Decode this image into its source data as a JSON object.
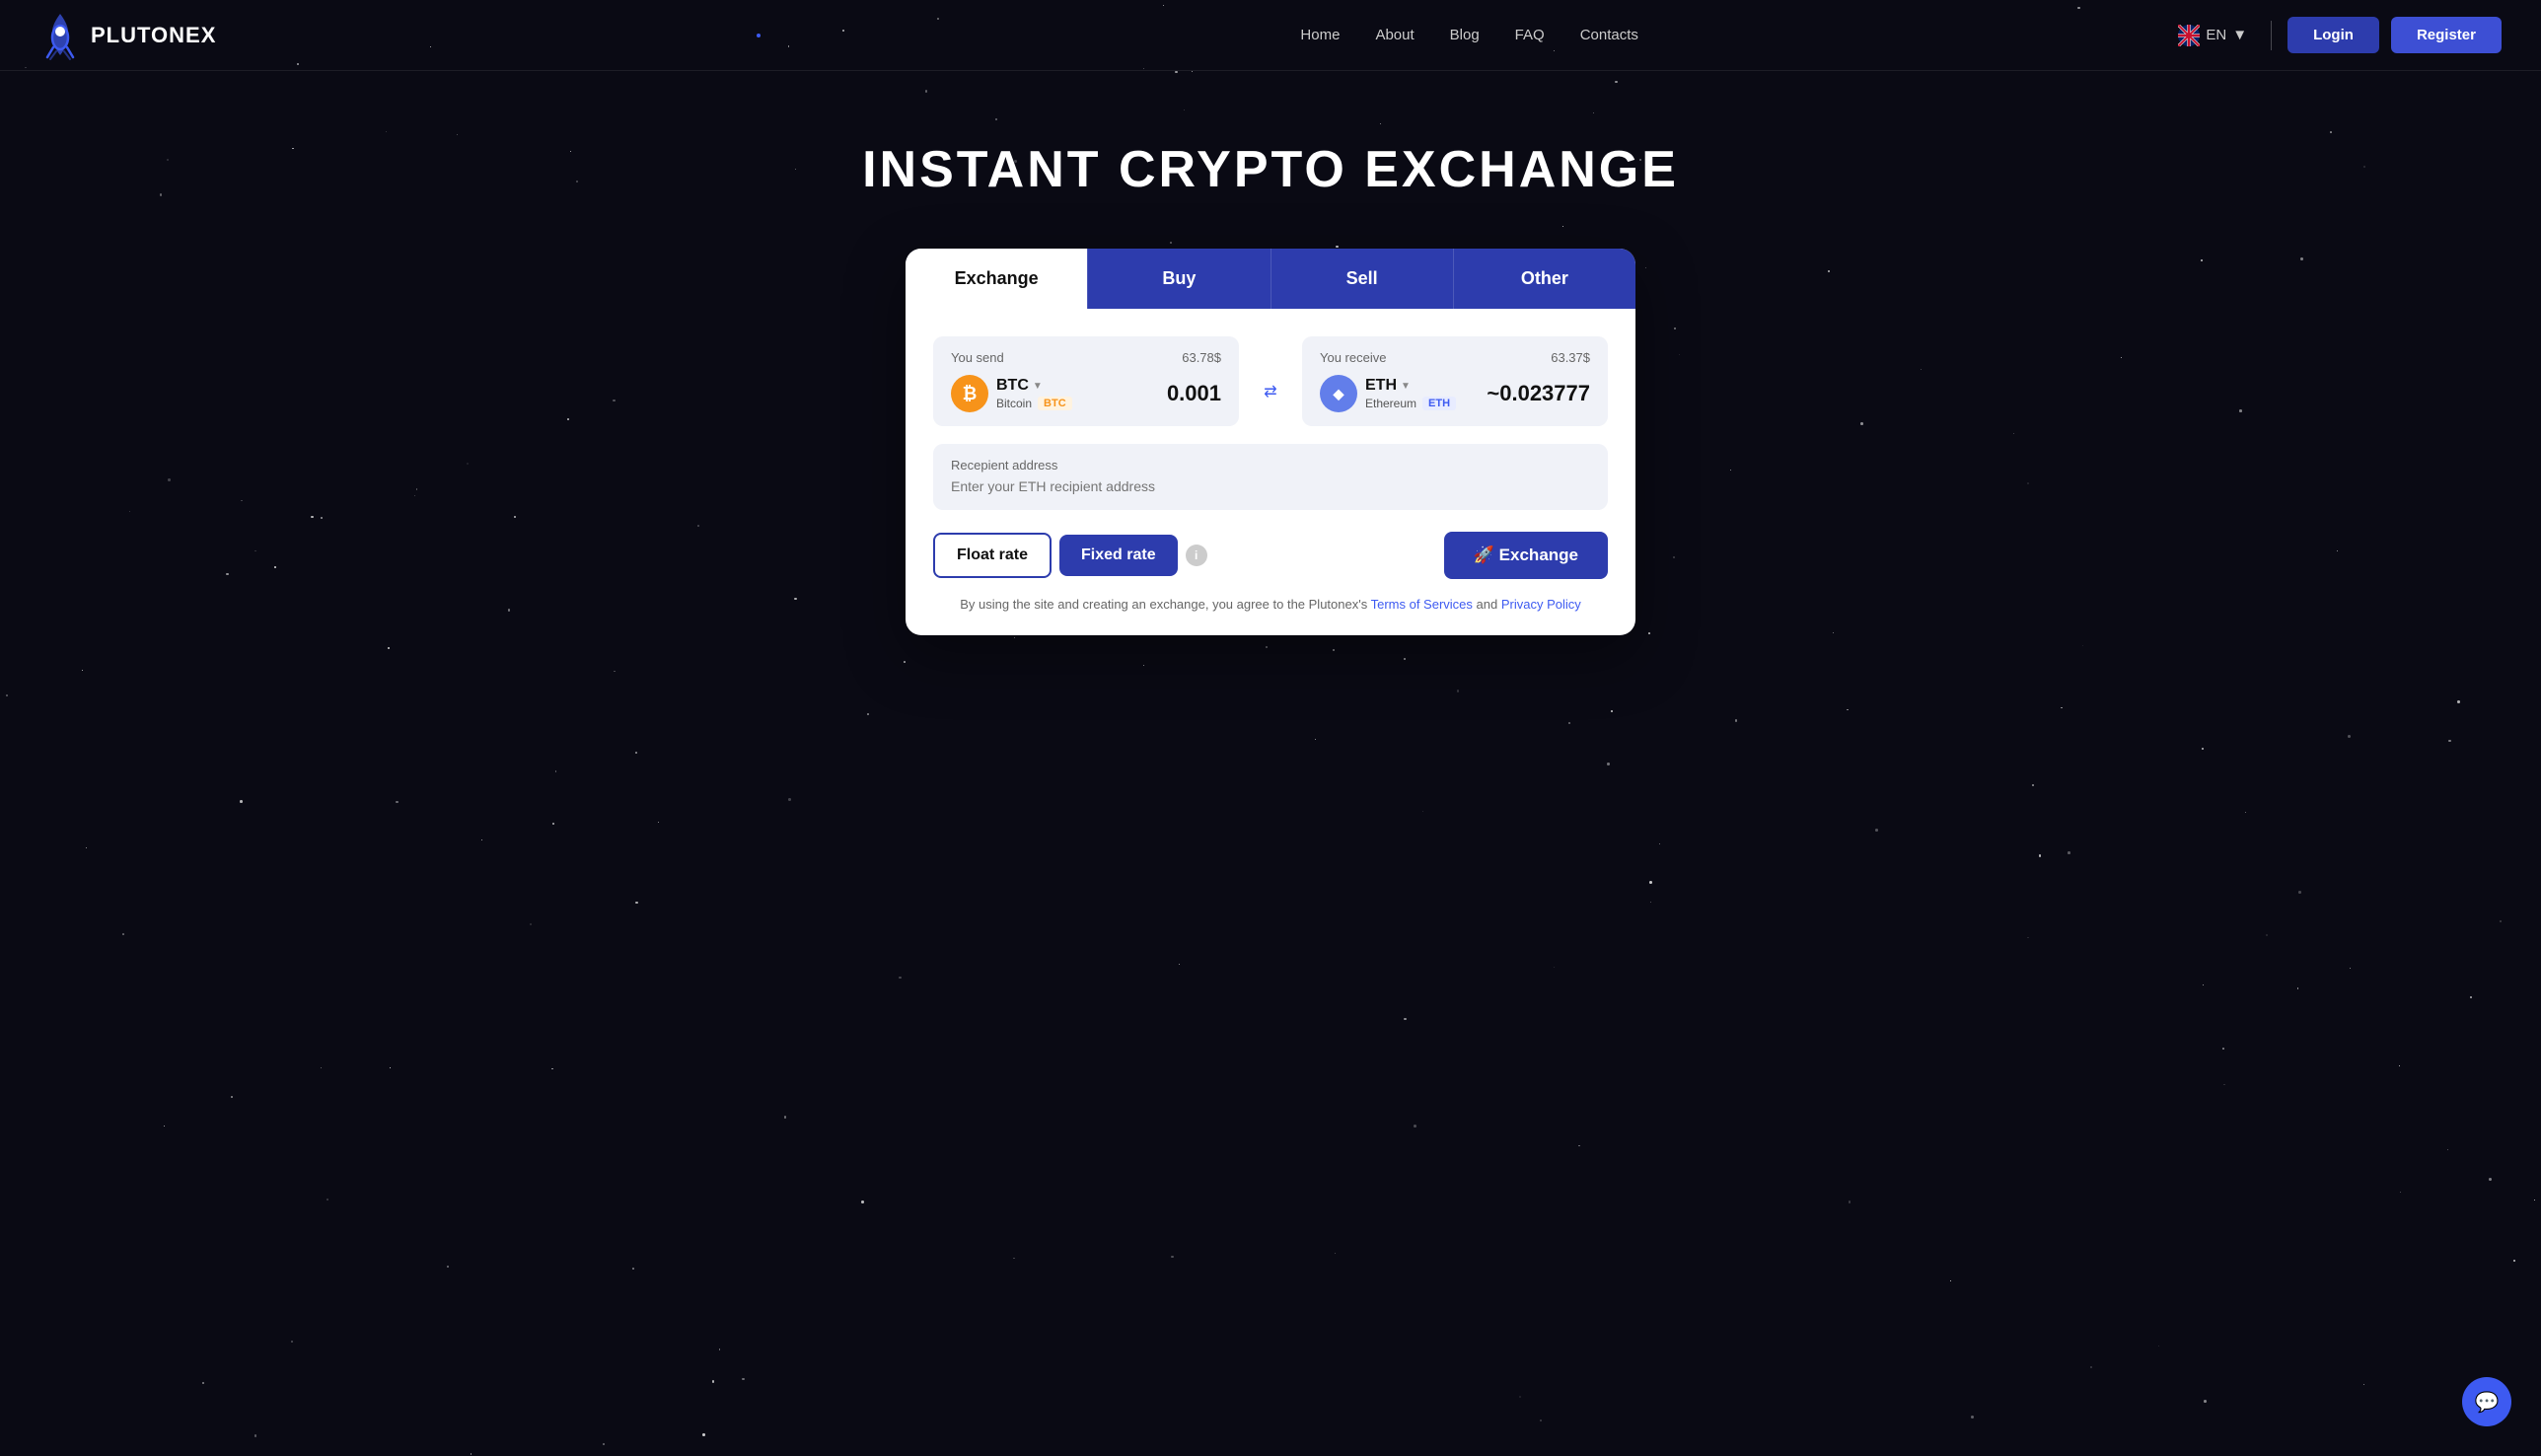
{
  "brand": {
    "name": "PLUTONEX"
  },
  "nav": {
    "links": [
      {
        "label": "Home",
        "href": "#"
      },
      {
        "label": "About",
        "href": "#"
      },
      {
        "label": "Blog",
        "href": "#"
      },
      {
        "label": "FAQ",
        "href": "#"
      },
      {
        "label": "Contacts",
        "href": "#"
      }
    ],
    "language": "EN",
    "login_label": "Login",
    "register_label": "Register"
  },
  "hero": {
    "title": "INSTANT CRYPTO EXCHANGE"
  },
  "exchange_card": {
    "tabs": [
      {
        "id": "exchange",
        "label": "Exchange",
        "active": true
      },
      {
        "id": "buy",
        "label": "Buy"
      },
      {
        "id": "sell",
        "label": "Sell"
      },
      {
        "id": "other",
        "label": "Other"
      }
    ],
    "send": {
      "label": "You send",
      "usd": "63.78$",
      "coin_symbol": "BTC",
      "coin_name": "Bitcoin",
      "coin_tag": "BTC",
      "amount": "0.001"
    },
    "receive": {
      "label": "You receive",
      "usd": "63.37$",
      "coin_symbol": "ETH",
      "coin_name": "Ethereum",
      "coin_tag": "ETH",
      "amount": "~0.023777"
    },
    "recipient": {
      "label": "Recepient address",
      "placeholder": "Enter your ETH recipient address"
    },
    "rate_buttons": {
      "float": "Float rate",
      "fixed": "Fixed rate"
    },
    "exchange_button": "🚀 Exchange",
    "terms_text": "By using the site and creating an exchange, you agree to the Plutonex's",
    "terms_link": "Terms of Services",
    "and_text": "and",
    "privacy_link": "Privacy Policy"
  },
  "chat": {
    "icon": "💬"
  }
}
